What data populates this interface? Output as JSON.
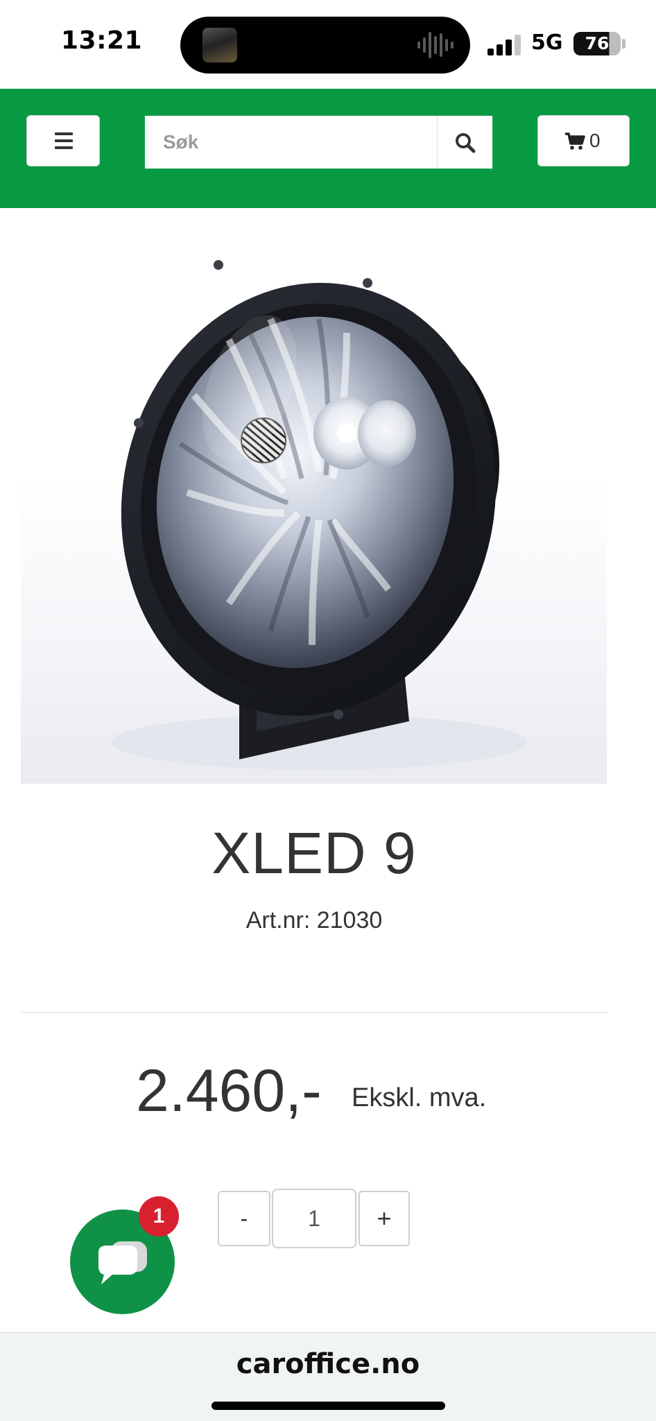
{
  "status_bar": {
    "time": "13:21",
    "network": "5G",
    "battery": "76"
  },
  "header": {
    "search_placeholder": "Søk",
    "cart_count": "0",
    "brand_color": "#089a43"
  },
  "product": {
    "title": "XLED 9",
    "article_number": "Art.nr: 21030",
    "price": "2.460,-",
    "vat_note": "Ekskl. mva.",
    "quantity": "1",
    "qty_minus_label": "-",
    "qty_plus_label": "+"
  },
  "chat": {
    "badge_count": "1"
  },
  "browser": {
    "url": "caroffice.no"
  },
  "icons": [
    "menu-icon",
    "search-icon",
    "cart-icon",
    "chat-icon",
    "signal-icon",
    "battery-icon"
  ]
}
